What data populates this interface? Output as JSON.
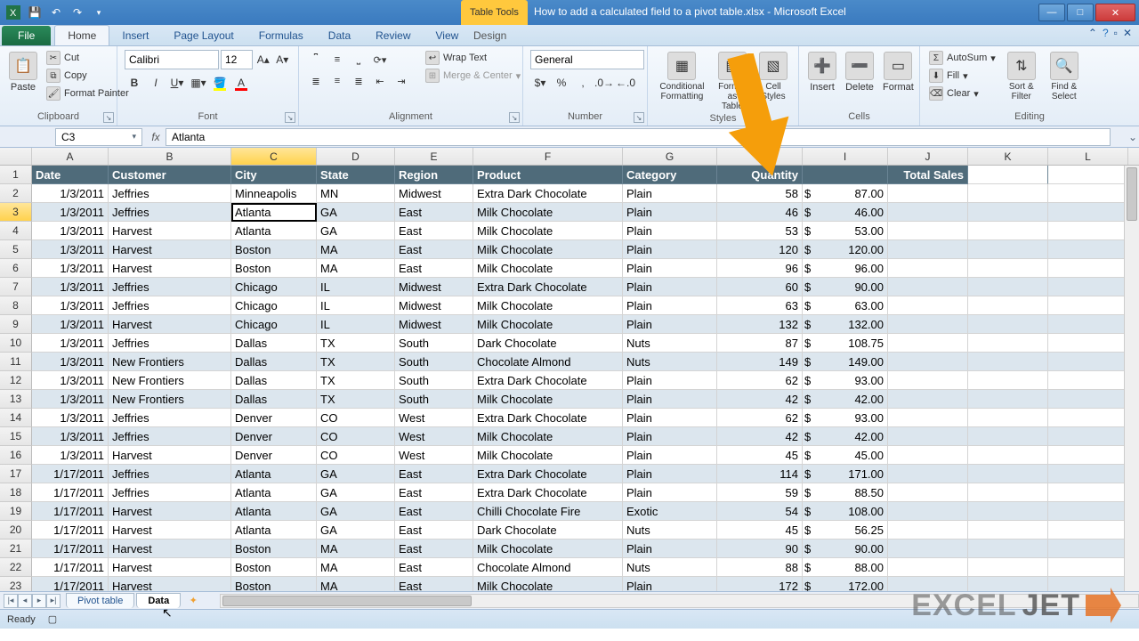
{
  "title": "How to add a calculated field to a pivot table.xlsx - Microsoft Excel",
  "context_tab": "Table Tools",
  "ribbon_tabs": [
    "File",
    "Home",
    "Insert",
    "Page Layout",
    "Formulas",
    "Data",
    "Review",
    "View",
    "Design"
  ],
  "clipboard": {
    "paste": "Paste",
    "cut": "Cut",
    "copy": "Copy",
    "format_painter": "Format Painter",
    "label": "Clipboard"
  },
  "font": {
    "name": "Calibri",
    "size": "12",
    "label": "Font"
  },
  "alignment": {
    "wrap": "Wrap Text",
    "merge": "Merge & Center",
    "label": "Alignment"
  },
  "number": {
    "format": "General",
    "label": "Number"
  },
  "styles": {
    "cond": "Conditional Formatting",
    "table": "Format as Table",
    "cell": "Cell Styles",
    "label": "Styles"
  },
  "cells": {
    "insert": "Insert",
    "delete": "Delete",
    "format": "Format",
    "label": "Cells"
  },
  "editing": {
    "autosum": "AutoSum",
    "fill": "Fill",
    "clear": "Clear",
    "sort": "Sort & Filter",
    "find": "Find & Select",
    "label": "Editing"
  },
  "name_box": "C3",
  "formula": "Atlanta",
  "columns": [
    "A",
    "B",
    "C",
    "D",
    "E",
    "F",
    "G",
    "H",
    "I",
    "J",
    "K",
    "L"
  ],
  "headers": [
    "Date",
    "Customer",
    "City",
    "State",
    "Region",
    "Product",
    "Category",
    "Quantity",
    "",
    "Total Sales"
  ],
  "selected_col_index": 2,
  "selected_row_index": 1,
  "chart_data": {
    "type": "table",
    "columns": [
      "Date",
      "Customer",
      "City",
      "State",
      "Region",
      "Product",
      "Category",
      "Quantity",
      "Total Sales"
    ],
    "rows": [
      [
        "1/3/2011",
        "Jeffries",
        "Minneapolis",
        "MN",
        "Midwest",
        "Extra Dark Chocolate",
        "Plain",
        58,
        87.0
      ],
      [
        "1/3/2011",
        "Jeffries",
        "Atlanta",
        "GA",
        "East",
        "Milk Chocolate",
        "Plain",
        46,
        46.0
      ],
      [
        "1/3/2011",
        "Harvest",
        "Atlanta",
        "GA",
        "East",
        "Milk Chocolate",
        "Plain",
        53,
        53.0
      ],
      [
        "1/3/2011",
        "Harvest",
        "Boston",
        "MA",
        "East",
        "Milk Chocolate",
        "Plain",
        120,
        120.0
      ],
      [
        "1/3/2011",
        "Harvest",
        "Boston",
        "MA",
        "East",
        "Milk Chocolate",
        "Plain",
        96,
        96.0
      ],
      [
        "1/3/2011",
        "Jeffries",
        "Chicago",
        "IL",
        "Midwest",
        "Extra Dark Chocolate",
        "Plain",
        60,
        90.0
      ],
      [
        "1/3/2011",
        "Jeffries",
        "Chicago",
        "IL",
        "Midwest",
        "Milk Chocolate",
        "Plain",
        63,
        63.0
      ],
      [
        "1/3/2011",
        "Harvest",
        "Chicago",
        "IL",
        "Midwest",
        "Milk Chocolate",
        "Plain",
        132,
        132.0
      ],
      [
        "1/3/2011",
        "Jeffries",
        "Dallas",
        "TX",
        "South",
        "Dark Chocolate",
        "Nuts",
        87,
        108.75
      ],
      [
        "1/3/2011",
        "New Frontiers",
        "Dallas",
        "TX",
        "South",
        "Chocolate Almond",
        "Nuts",
        149,
        149.0
      ],
      [
        "1/3/2011",
        "New Frontiers",
        "Dallas",
        "TX",
        "South",
        "Extra Dark Chocolate",
        "Plain",
        62,
        93.0
      ],
      [
        "1/3/2011",
        "New Frontiers",
        "Dallas",
        "TX",
        "South",
        "Milk Chocolate",
        "Plain",
        42,
        42.0
      ],
      [
        "1/3/2011",
        "Jeffries",
        "Denver",
        "CO",
        "West",
        "Extra Dark Chocolate",
        "Plain",
        62,
        93.0
      ],
      [
        "1/3/2011",
        "Jeffries",
        "Denver",
        "CO",
        "West",
        "Milk Chocolate",
        "Plain",
        42,
        42.0
      ],
      [
        "1/3/2011",
        "Harvest",
        "Denver",
        "CO",
        "West",
        "Milk Chocolate",
        "Plain",
        45,
        45.0
      ],
      [
        "1/17/2011",
        "Jeffries",
        "Atlanta",
        "GA",
        "East",
        "Extra Dark Chocolate",
        "Plain",
        114,
        171.0
      ],
      [
        "1/17/2011",
        "Jeffries",
        "Atlanta",
        "GA",
        "East",
        "Extra Dark Chocolate",
        "Plain",
        59,
        88.5
      ],
      [
        "1/17/2011",
        "Harvest",
        "Atlanta",
        "GA",
        "East",
        "Chilli Chocolate Fire",
        "Exotic",
        54,
        108.0
      ],
      [
        "1/17/2011",
        "Harvest",
        "Atlanta",
        "GA",
        "East",
        "Dark Chocolate",
        "Nuts",
        45,
        56.25
      ],
      [
        "1/17/2011",
        "Harvest",
        "Boston",
        "MA",
        "East",
        "Milk Chocolate",
        "Plain",
        90,
        90.0
      ],
      [
        "1/17/2011",
        "Harvest",
        "Boston",
        "MA",
        "East",
        "Chocolate Almond",
        "Nuts",
        88,
        88.0
      ],
      [
        "1/17/2011",
        "Harvest",
        "Boston",
        "MA",
        "East",
        "Milk Chocolate",
        "Plain",
        172,
        172.0
      ]
    ]
  },
  "sheet_tabs": [
    "Pivot table",
    "Data"
  ],
  "status": "Ready",
  "watermark": {
    "a": "EXCEL",
    "b": "JET"
  },
  "currency": "$"
}
